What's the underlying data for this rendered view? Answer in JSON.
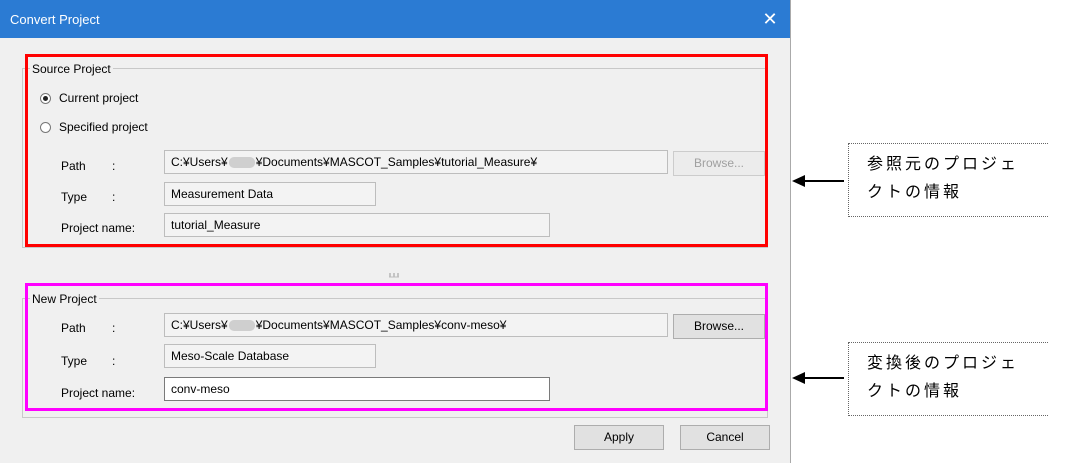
{
  "window": {
    "title": "Convert Project",
    "close_glyph": "✕"
  },
  "source_project": {
    "group_label": "Source Project",
    "radio_current": "Current project",
    "radio_specified": "Specified project",
    "selected": "current",
    "path_label": "Path",
    "path_prefix": "C:¥Users¥",
    "path_suffix": "¥Documents¥MASCOT_Samples¥tutorial_Measure¥",
    "browse_label": "Browse...",
    "type_label": "Type",
    "type_value": "Measurement Data",
    "project_name_label": "Project name:",
    "project_name_value": "tutorial_Measure"
  },
  "new_project": {
    "group_label": "New Project",
    "path_label": "Path",
    "path_prefix": "C:¥Users¥",
    "path_suffix": "¥Documents¥MASCOT_Samples¥conv-meso¥",
    "browse_label": "Browse...",
    "type_label": "Type",
    "type_value": "Meso-Scale Database",
    "project_name_label": "Project name:",
    "project_name_value": "conv-meso"
  },
  "colon": ":",
  "buttons": {
    "apply": "Apply",
    "cancel": "Cancel"
  },
  "annotations": {
    "source_note": [
      "参照元のプロジェ",
      "クトの情報"
    ],
    "new_note": [
      "変換後のプロジェ",
      "クトの情報"
    ]
  },
  "colors": {
    "titlebar": "#2b7bd3",
    "source_highlight": "#ff0000",
    "new_highlight": "#ff00ff"
  }
}
